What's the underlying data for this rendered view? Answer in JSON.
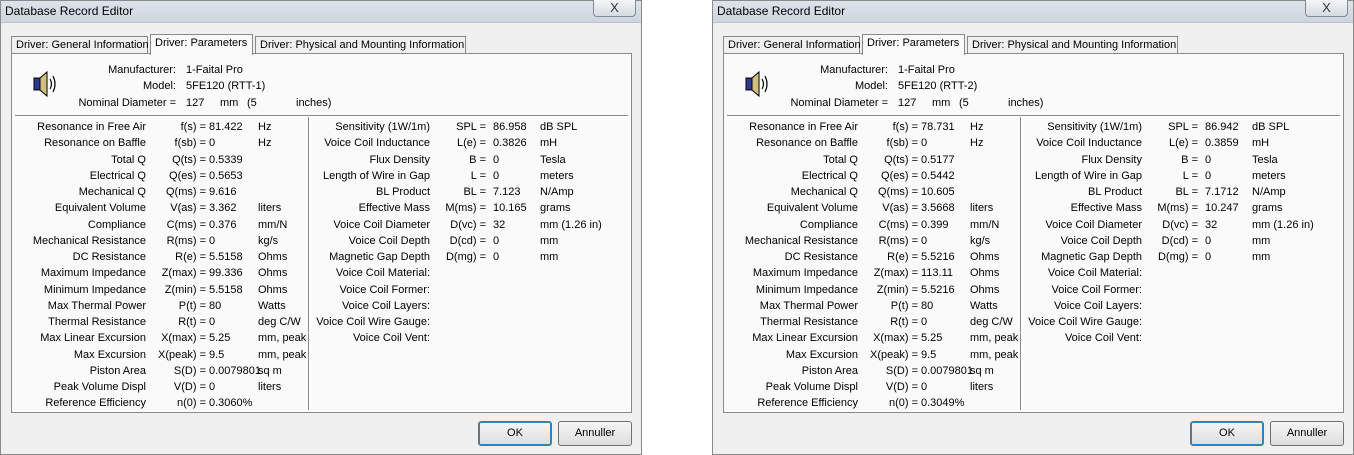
{
  "windows": [
    {
      "title": "Database Record Editor",
      "close": "X",
      "tabs": [
        "Driver:  General Information",
        "Driver:  Parameters",
        "Driver:  Physical and Mounting Information"
      ],
      "active_tab": 1,
      "header": {
        "manufacturer_label": "Manufacturer:",
        "manufacturer": "1-Faital Pro",
        "model_label": "Model:",
        "model": "5FE120 (RTT-1)",
        "diameter_label": "Nominal Diameter =",
        "diameter": "127",
        "diameter_unit": "mm",
        "diameter_paren": "(5",
        "diameter_in": "inches)"
      },
      "left_rows": [
        {
          "label": "Resonance in Free Air",
          "sym": "f(s) =",
          "val": "81.422",
          "unit": "Hz"
        },
        {
          "label": "Resonance on Baffle",
          "sym": "f(sb) =",
          "val": "0",
          "unit": "Hz"
        },
        {
          "label": "Total Q",
          "sym": "Q(ts) =",
          "val": "0.5339",
          "unit": ""
        },
        {
          "label": "Electrical Q",
          "sym": "Q(es) =",
          "val": "0.5653",
          "unit": ""
        },
        {
          "label": "Mechanical Q",
          "sym": "Q(ms) =",
          "val": "9.616",
          "unit": ""
        },
        {
          "label": "Equivalent Volume",
          "sym": "V(as) =",
          "val": "3.362",
          "unit": "liters"
        },
        {
          "label": "Compliance",
          "sym": "C(ms) =",
          "val": "0.376",
          "unit": "mm/N"
        },
        {
          "label": "Mechanical Resistance",
          "sym": "R(ms) =",
          "val": "0",
          "unit": "kg/s"
        },
        {
          "label": "DC Resistance",
          "sym": "R(e) =",
          "val": "5.5158",
          "unit": "Ohms"
        },
        {
          "label": "Maximum Impedance",
          "sym": "Z(max) =",
          "val": "99.336",
          "unit": "Ohms"
        },
        {
          "label": "Minimum Impedance",
          "sym": "Z(min) =",
          "val": "5.5158",
          "unit": "Ohms"
        },
        {
          "label": "Max Thermal Power",
          "sym": "P(t) =",
          "val": "80",
          "unit": "Watts"
        },
        {
          "label": "Thermal Resistance",
          "sym": "R(t) =",
          "val": "0",
          "unit": "deg C/W"
        },
        {
          "label": "Max Linear Excursion",
          "sym": "X(max) =",
          "val": "5.25",
          "unit": "mm, peak"
        },
        {
          "label": "Max Excursion",
          "sym": "X(peak) =",
          "val": "9.5",
          "unit": "mm, peak"
        },
        {
          "label": "Piston Area",
          "sym": "S(D) =",
          "val": "0.0079801",
          "unit": "sq m"
        },
        {
          "label": "Peak Volume Displ",
          "sym": "V(D) =",
          "val": "0",
          "unit": "liters"
        },
        {
          "label": "Reference Efficiency",
          "sym": "n(0) =",
          "val": "0.3060%",
          "unit": ""
        }
      ],
      "right_rows": [
        {
          "label": "Sensitivity (1W/1m)",
          "sym": "SPL =",
          "val": "86.958",
          "unit": "dB SPL"
        },
        {
          "label": "Voice Coil Inductance",
          "sym": "L(e) =",
          "val": "0.3826",
          "unit": "mH"
        },
        {
          "label": "Flux Density",
          "sym": "B =",
          "val": "0",
          "unit": "Tesla"
        },
        {
          "label": "Length of Wire in Gap",
          "sym": "L =",
          "val": "0",
          "unit": "meters"
        },
        {
          "label": "BL Product",
          "sym": "BL =",
          "val": "7.123",
          "unit": "N/Amp"
        },
        {
          "label": "Effective Mass",
          "sym": "M(ms) =",
          "val": "10.165",
          "unit": "grams"
        },
        {
          "label": "Voice Coil Diameter",
          "sym": "D(vc) =",
          "val": "32",
          "unit": "mm      (1.26      in)"
        },
        {
          "label": "Voice Coil Depth",
          "sym": "D(cd) =",
          "val": "0",
          "unit": "mm"
        },
        {
          "label": "Magnetic Gap Depth",
          "sym": "D(mg) =",
          "val": "0",
          "unit": "mm"
        },
        {
          "label": "Voice Coil Material:",
          "sym": "",
          "val": "",
          "unit": ""
        },
        {
          "label": "Voice Coil Former:",
          "sym": "",
          "val": "",
          "unit": ""
        },
        {
          "label": "Voice Coil Layers:",
          "sym": "",
          "val": "",
          "unit": ""
        },
        {
          "label": "Voice Coil Wire Gauge:",
          "sym": "",
          "val": "",
          "unit": ""
        },
        {
          "label": "Voice Coil Vent:",
          "sym": "",
          "val": "",
          "unit": ""
        }
      ],
      "ok": "OK",
      "cancel": "Annuller"
    },
    {
      "title": "Database Record Editor",
      "close": "X",
      "tabs": [
        "Driver:  General Information",
        "Driver:  Parameters",
        "Driver:  Physical and Mounting Information"
      ],
      "active_tab": 1,
      "header": {
        "manufacturer_label": "Manufacturer:",
        "manufacturer": "1-Faital Pro",
        "model_label": "Model:",
        "model": "5FE120 (RTT-2)",
        "diameter_label": "Nominal Diameter =",
        "diameter": "127",
        "diameter_unit": "mm",
        "diameter_paren": "(5",
        "diameter_in": "inches)"
      },
      "left_rows": [
        {
          "label": "Resonance in Free Air",
          "sym": "f(s) =",
          "val": "78.731",
          "unit": "Hz"
        },
        {
          "label": "Resonance on Baffle",
          "sym": "f(sb) =",
          "val": "0",
          "unit": "Hz"
        },
        {
          "label": "Total Q",
          "sym": "Q(ts) =",
          "val": "0.5177",
          "unit": ""
        },
        {
          "label": "Electrical Q",
          "sym": "Q(es) =",
          "val": "0.5442",
          "unit": ""
        },
        {
          "label": "Mechanical Q",
          "sym": "Q(ms) =",
          "val": "10.605",
          "unit": ""
        },
        {
          "label": "Equivalent Volume",
          "sym": "V(as) =",
          "val": "3.5668",
          "unit": "liters"
        },
        {
          "label": "Compliance",
          "sym": "C(ms) =",
          "val": "0.399",
          "unit": "mm/N"
        },
        {
          "label": "Mechanical Resistance",
          "sym": "R(ms) =",
          "val": "0",
          "unit": "kg/s"
        },
        {
          "label": "DC Resistance",
          "sym": "R(e) =",
          "val": "5.5216",
          "unit": "Ohms"
        },
        {
          "label": "Maximum Impedance",
          "sym": "Z(max) =",
          "val": "113.11",
          "unit": "Ohms"
        },
        {
          "label": "Minimum Impedance",
          "sym": "Z(min) =",
          "val": "5.5216",
          "unit": "Ohms"
        },
        {
          "label": "Max Thermal Power",
          "sym": "P(t) =",
          "val": "80",
          "unit": "Watts"
        },
        {
          "label": "Thermal Resistance",
          "sym": "R(t) =",
          "val": "0",
          "unit": "deg C/W"
        },
        {
          "label": "Max Linear Excursion",
          "sym": "X(max) =",
          "val": "5.25",
          "unit": "mm, peak"
        },
        {
          "label": "Max Excursion",
          "sym": "X(peak) =",
          "val": "9.5",
          "unit": "mm, peak"
        },
        {
          "label": "Piston Area",
          "sym": "S(D) =",
          "val": "0.0079801",
          "unit": "sq m"
        },
        {
          "label": "Peak Volume Displ",
          "sym": "V(D) =",
          "val": "0",
          "unit": "liters"
        },
        {
          "label": "Reference Efficiency",
          "sym": "n(0) =",
          "val": "0.3049%",
          "unit": ""
        }
      ],
      "right_rows": [
        {
          "label": "Sensitivity (1W/1m)",
          "sym": "SPL =",
          "val": "86.942",
          "unit": "dB SPL"
        },
        {
          "label": "Voice Coil Inductance",
          "sym": "L(e) =",
          "val": "0.3859",
          "unit": "mH"
        },
        {
          "label": "Flux Density",
          "sym": "B =",
          "val": "0",
          "unit": "Tesla"
        },
        {
          "label": "Length of Wire in Gap",
          "sym": "L =",
          "val": "0",
          "unit": "meters"
        },
        {
          "label": "BL Product",
          "sym": "BL =",
          "val": "7.1712",
          "unit": "N/Amp"
        },
        {
          "label": "Effective Mass",
          "sym": "M(ms) =",
          "val": "10.247",
          "unit": "grams"
        },
        {
          "label": "Voice Coil Diameter",
          "sym": "D(vc) =",
          "val": "32",
          "unit": "mm      (1.26      in)"
        },
        {
          "label": "Voice Coil Depth",
          "sym": "D(cd) =",
          "val": "0",
          "unit": "mm"
        },
        {
          "label": "Magnetic Gap Depth",
          "sym": "D(mg) =",
          "val": "0",
          "unit": "mm"
        },
        {
          "label": "Voice Coil Material:",
          "sym": "",
          "val": "",
          "unit": ""
        },
        {
          "label": "Voice Coil Former:",
          "sym": "",
          "val": "",
          "unit": ""
        },
        {
          "label": "Voice Coil Layers:",
          "sym": "",
          "val": "",
          "unit": ""
        },
        {
          "label": "Voice Coil Wire Gauge:",
          "sym": "",
          "val": "",
          "unit": ""
        },
        {
          "label": "Voice Coil Vent:",
          "sym": "",
          "val": "",
          "unit": ""
        }
      ],
      "ok": "OK",
      "cancel": "Annuller"
    }
  ]
}
